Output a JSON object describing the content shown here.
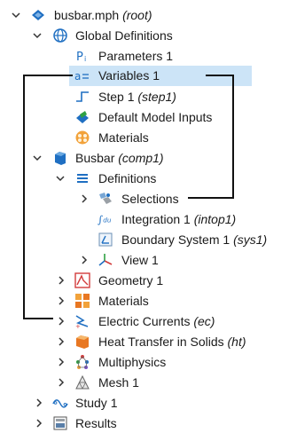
{
  "tree": {
    "root": {
      "label": "busbar.mph",
      "suffix": "(root)"
    },
    "global_definitions": {
      "label": "Global Definitions"
    },
    "parameters": {
      "label": "Parameters 1"
    },
    "variables": {
      "label": "Variables 1"
    },
    "step": {
      "label": "Step 1",
      "suffix": "(step1)"
    },
    "default_inputs": {
      "label": "Default Model Inputs"
    },
    "materials_global": {
      "label": "Materials"
    },
    "busbar": {
      "label": "Busbar",
      "suffix": "(comp1)"
    },
    "definitions": {
      "label": "Definitions"
    },
    "selections": {
      "label": "Selections"
    },
    "integration": {
      "label": "Integration 1",
      "suffix": "(intop1)"
    },
    "boundary_system": {
      "label": "Boundary System 1",
      "suffix": "(sys1)"
    },
    "view": {
      "label": "View 1"
    },
    "geometry": {
      "label": "Geometry 1"
    },
    "materials_comp": {
      "label": "Materials"
    },
    "electric_currents": {
      "label": "Electric Currents",
      "suffix": "(ec)"
    },
    "heat_transfer": {
      "label": "Heat Transfer in Solids",
      "suffix": "(ht)"
    },
    "multiphysics": {
      "label": "Multiphysics"
    },
    "mesh": {
      "label": "Mesh 1"
    },
    "study": {
      "label": "Study 1"
    },
    "results": {
      "label": "Results"
    }
  },
  "colors": {
    "selection": "#cce4f7",
    "accent_blue": "#1f6fc2",
    "bracket": "#111111"
  }
}
